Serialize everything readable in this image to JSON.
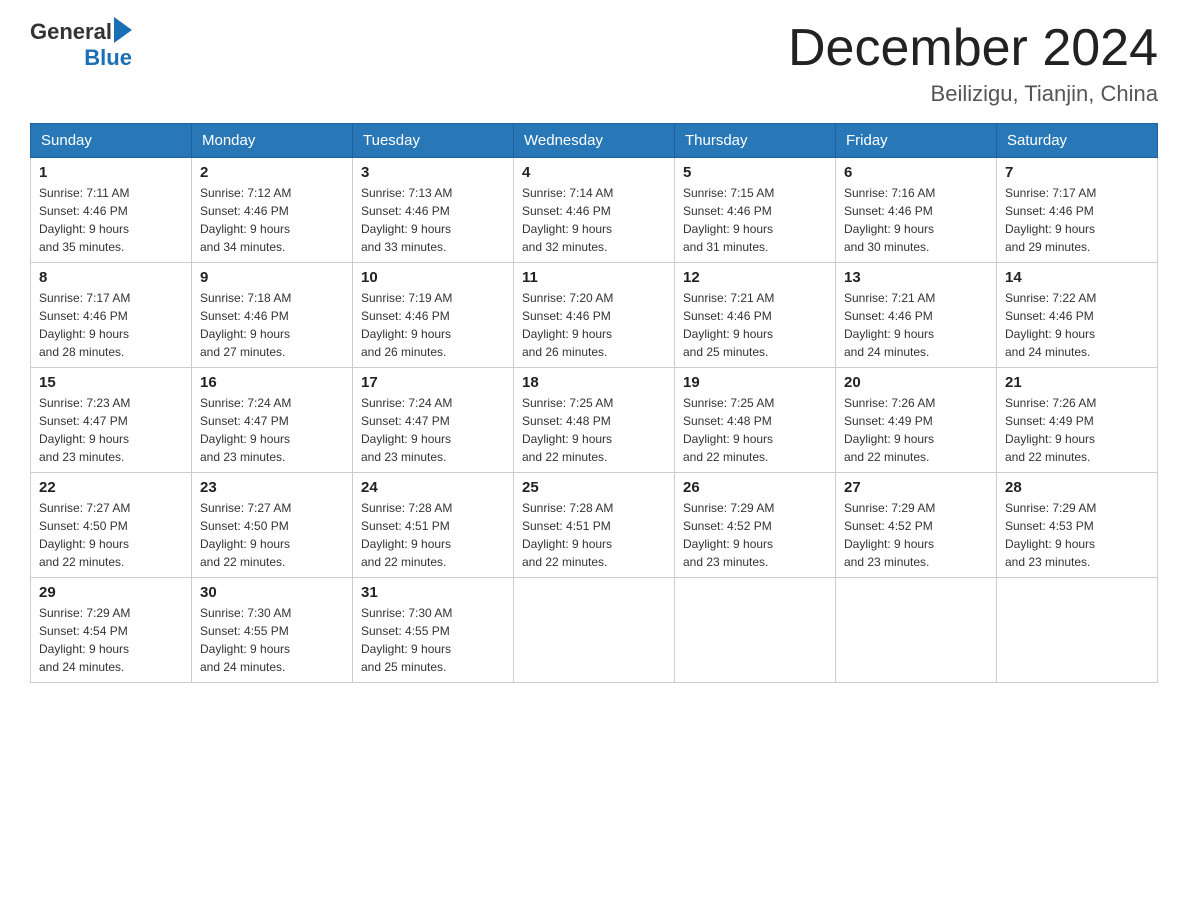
{
  "header": {
    "logo_general": "General",
    "logo_blue": "Blue",
    "title": "December 2024",
    "subtitle": "Beilizigu, Tianjin, China"
  },
  "weekdays": [
    "Sunday",
    "Monday",
    "Tuesday",
    "Wednesday",
    "Thursday",
    "Friday",
    "Saturday"
  ],
  "weeks": [
    [
      {
        "day": "1",
        "sunrise": "7:11 AM",
        "sunset": "4:46 PM",
        "daylight": "9 hours and 35 minutes."
      },
      {
        "day": "2",
        "sunrise": "7:12 AM",
        "sunset": "4:46 PM",
        "daylight": "9 hours and 34 minutes."
      },
      {
        "day": "3",
        "sunrise": "7:13 AM",
        "sunset": "4:46 PM",
        "daylight": "9 hours and 33 minutes."
      },
      {
        "day": "4",
        "sunrise": "7:14 AM",
        "sunset": "4:46 PM",
        "daylight": "9 hours and 32 minutes."
      },
      {
        "day": "5",
        "sunrise": "7:15 AM",
        "sunset": "4:46 PM",
        "daylight": "9 hours and 31 minutes."
      },
      {
        "day": "6",
        "sunrise": "7:16 AM",
        "sunset": "4:46 PM",
        "daylight": "9 hours and 30 minutes."
      },
      {
        "day": "7",
        "sunrise": "7:17 AM",
        "sunset": "4:46 PM",
        "daylight": "9 hours and 29 minutes."
      }
    ],
    [
      {
        "day": "8",
        "sunrise": "7:17 AM",
        "sunset": "4:46 PM",
        "daylight": "9 hours and 28 minutes."
      },
      {
        "day": "9",
        "sunrise": "7:18 AM",
        "sunset": "4:46 PM",
        "daylight": "9 hours and 27 minutes."
      },
      {
        "day": "10",
        "sunrise": "7:19 AM",
        "sunset": "4:46 PM",
        "daylight": "9 hours and 26 minutes."
      },
      {
        "day": "11",
        "sunrise": "7:20 AM",
        "sunset": "4:46 PM",
        "daylight": "9 hours and 26 minutes."
      },
      {
        "day": "12",
        "sunrise": "7:21 AM",
        "sunset": "4:46 PM",
        "daylight": "9 hours and 25 minutes."
      },
      {
        "day": "13",
        "sunrise": "7:21 AM",
        "sunset": "4:46 PM",
        "daylight": "9 hours and 24 minutes."
      },
      {
        "day": "14",
        "sunrise": "7:22 AM",
        "sunset": "4:46 PM",
        "daylight": "9 hours and 24 minutes."
      }
    ],
    [
      {
        "day": "15",
        "sunrise": "7:23 AM",
        "sunset": "4:47 PM",
        "daylight": "9 hours and 23 minutes."
      },
      {
        "day": "16",
        "sunrise": "7:24 AM",
        "sunset": "4:47 PM",
        "daylight": "9 hours and 23 minutes."
      },
      {
        "day": "17",
        "sunrise": "7:24 AM",
        "sunset": "4:47 PM",
        "daylight": "9 hours and 23 minutes."
      },
      {
        "day": "18",
        "sunrise": "7:25 AM",
        "sunset": "4:48 PM",
        "daylight": "9 hours and 22 minutes."
      },
      {
        "day": "19",
        "sunrise": "7:25 AM",
        "sunset": "4:48 PM",
        "daylight": "9 hours and 22 minutes."
      },
      {
        "day": "20",
        "sunrise": "7:26 AM",
        "sunset": "4:49 PM",
        "daylight": "9 hours and 22 minutes."
      },
      {
        "day": "21",
        "sunrise": "7:26 AM",
        "sunset": "4:49 PM",
        "daylight": "9 hours and 22 minutes."
      }
    ],
    [
      {
        "day": "22",
        "sunrise": "7:27 AM",
        "sunset": "4:50 PM",
        "daylight": "9 hours and 22 minutes."
      },
      {
        "day": "23",
        "sunrise": "7:27 AM",
        "sunset": "4:50 PM",
        "daylight": "9 hours and 22 minutes."
      },
      {
        "day": "24",
        "sunrise": "7:28 AM",
        "sunset": "4:51 PM",
        "daylight": "9 hours and 22 minutes."
      },
      {
        "day": "25",
        "sunrise": "7:28 AM",
        "sunset": "4:51 PM",
        "daylight": "9 hours and 22 minutes."
      },
      {
        "day": "26",
        "sunrise": "7:29 AM",
        "sunset": "4:52 PM",
        "daylight": "9 hours and 23 minutes."
      },
      {
        "day": "27",
        "sunrise": "7:29 AM",
        "sunset": "4:52 PM",
        "daylight": "9 hours and 23 minutes."
      },
      {
        "day": "28",
        "sunrise": "7:29 AM",
        "sunset": "4:53 PM",
        "daylight": "9 hours and 23 minutes."
      }
    ],
    [
      {
        "day": "29",
        "sunrise": "7:29 AM",
        "sunset": "4:54 PM",
        "daylight": "9 hours and 24 minutes."
      },
      {
        "day": "30",
        "sunrise": "7:30 AM",
        "sunset": "4:55 PM",
        "daylight": "9 hours and 24 minutes."
      },
      {
        "day": "31",
        "sunrise": "7:30 AM",
        "sunset": "4:55 PM",
        "daylight": "9 hours and 25 minutes."
      },
      null,
      null,
      null,
      null
    ]
  ],
  "labels": {
    "sunrise": "Sunrise:",
    "sunset": "Sunset:",
    "daylight": "Daylight:"
  }
}
